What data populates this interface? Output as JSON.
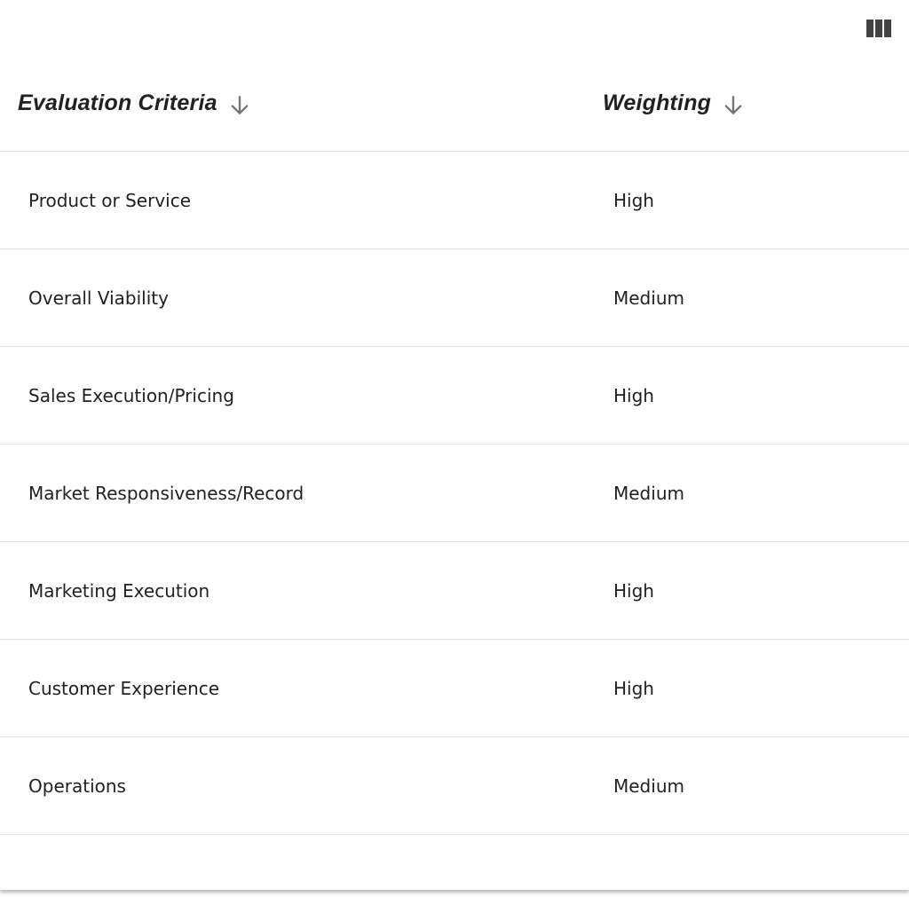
{
  "toolbar": {
    "columns_icon": "view-column-icon"
  },
  "table": {
    "headers": [
      {
        "label": "Evaluation Criteria",
        "sort_icon": "arrow-down-icon"
      },
      {
        "label": "Weighting",
        "sort_icon": "arrow-down-icon"
      }
    ],
    "rows": [
      {
        "criteria": "Product or Service",
        "weighting": "High"
      },
      {
        "criteria": "Overall Viability",
        "weighting": "Medium"
      },
      {
        "criteria": "Sales Execution/Pricing",
        "weighting": "High"
      },
      {
        "criteria": "Market Responsiveness/Record",
        "weighting": "Medium"
      },
      {
        "criteria": "Marketing Execution",
        "weighting": "High"
      },
      {
        "criteria": "Customer Experience",
        "weighting": "High"
      },
      {
        "criteria": "Operations",
        "weighting": "Medium"
      }
    ]
  },
  "colors": {
    "text": "#212121",
    "divider": "#e0e0e0",
    "icon": "#757575"
  }
}
